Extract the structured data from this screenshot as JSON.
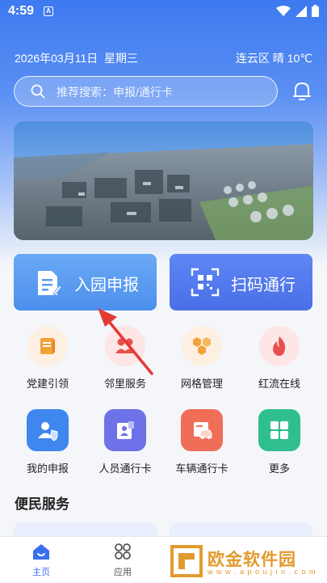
{
  "status_bar": {
    "time": "4:59",
    "notification_glyph": "A"
  },
  "header": {
    "date": "2026年03月11日  星期三",
    "weather": "连云区 晴 10℃",
    "search_placeholder": "推荐搜索：申报/通行卡"
  },
  "primary_actions": [
    {
      "label": "入园申报",
      "icon": "document-edit-icon"
    },
    {
      "label": "扫码通行",
      "icon": "qr-scan-icon"
    }
  ],
  "services": [
    {
      "label": "党建引领",
      "icon": "book-icon",
      "color": "#f2a13a"
    },
    {
      "label": "邻里服务",
      "icon": "people-icon",
      "color": "#e8514a"
    },
    {
      "label": "网格管理",
      "icon": "hexagon-grid-icon",
      "color": "#f2a23b"
    },
    {
      "label": "红流在线",
      "icon": "flame-icon",
      "color": "#ea4f4f"
    },
    {
      "label": "我的申报",
      "icon": "user-shield-icon",
      "color": "#3f86ef"
    },
    {
      "label": "人员通行卡",
      "icon": "id-card-icon",
      "color": "#6d72e8"
    },
    {
      "label": "车辆通行卡",
      "icon": "car-card-icon",
      "color": "#f06d57"
    },
    {
      "label": "更多",
      "icon": "apps-grid-icon",
      "color": "#2fbf8e"
    }
  ],
  "section": {
    "title": "便民服务"
  },
  "tabs": [
    {
      "label": "主页",
      "icon": "home-icon",
      "active": true
    },
    {
      "label": "应用",
      "icon": "apps-icon",
      "active": false
    }
  ],
  "watermark": {
    "title": "欧金软件园",
    "url": "w w w . a p o u j i n . c o m"
  }
}
